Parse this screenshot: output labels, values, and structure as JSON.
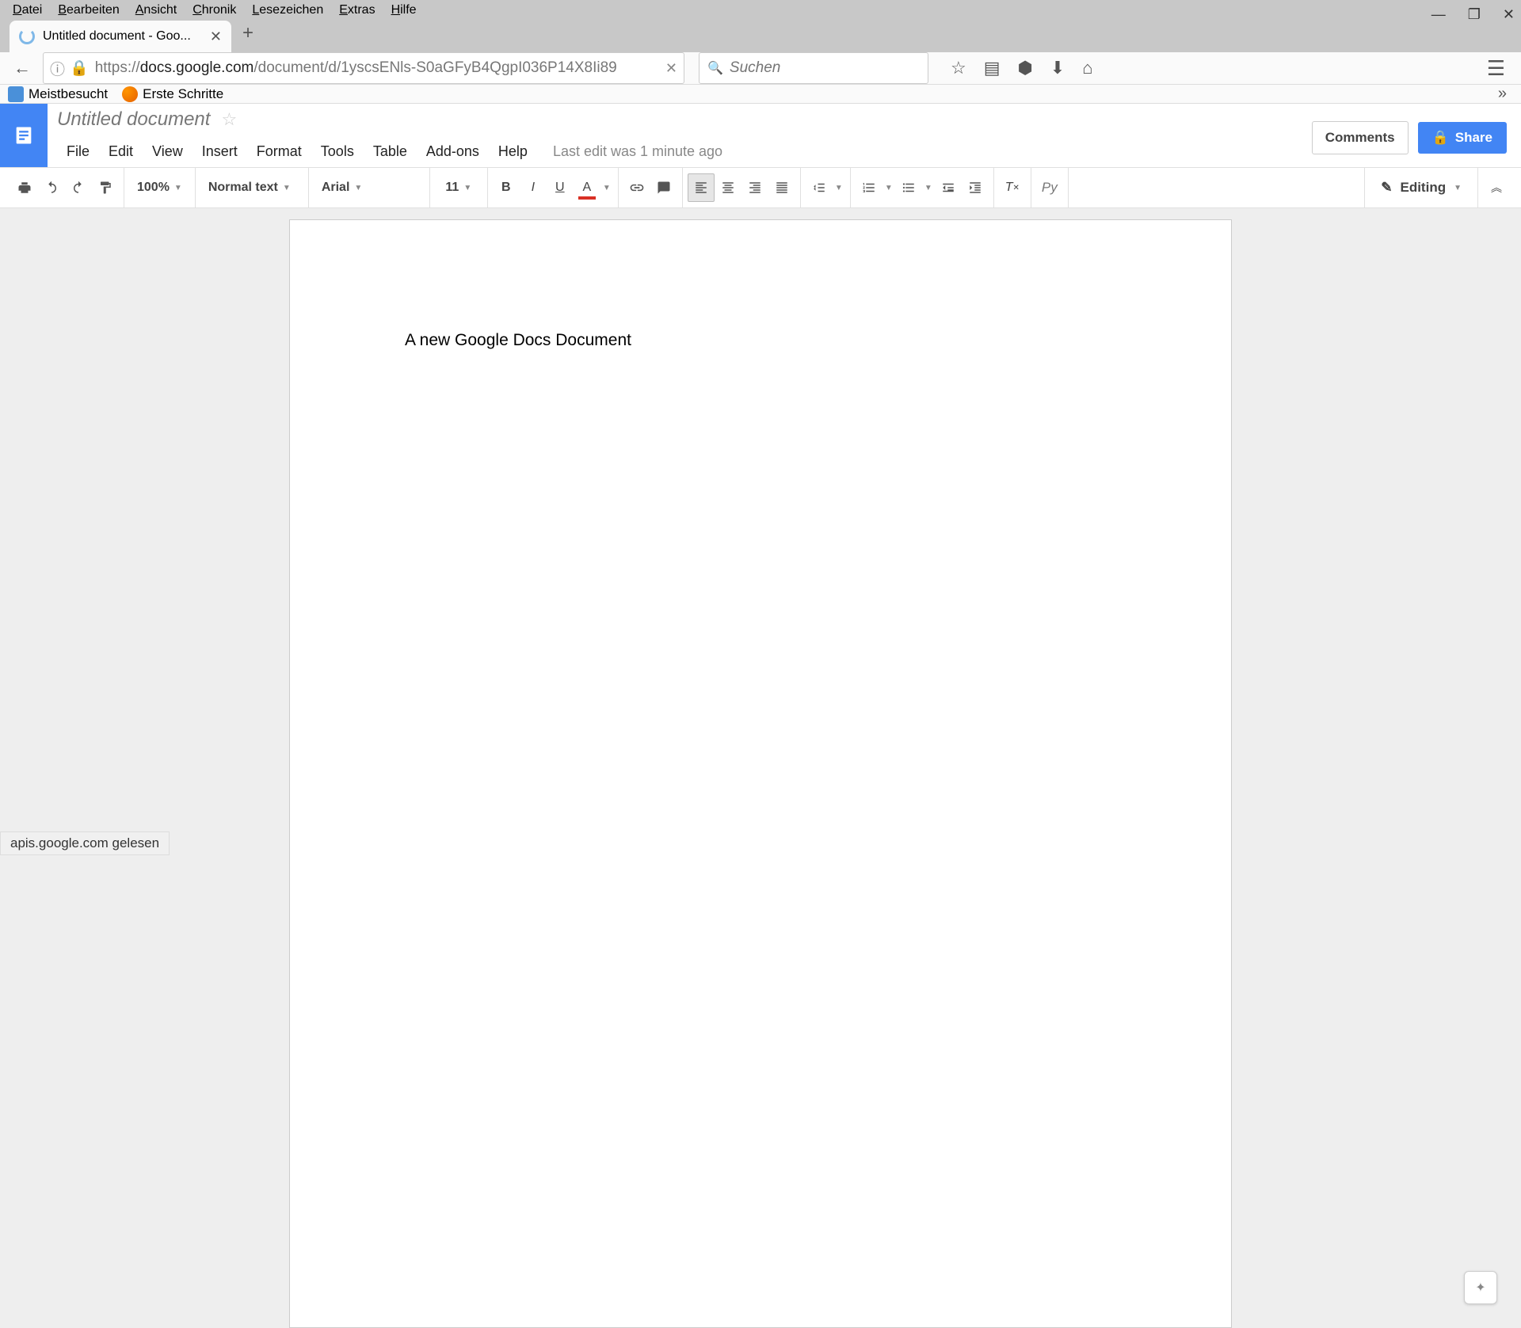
{
  "firefox": {
    "menubar": [
      "Datei",
      "Bearbeiten",
      "Ansicht",
      "Chronik",
      "Lesezeichen",
      "Extras",
      "Hilfe"
    ],
    "tab_title": "Untitled document - Goo...",
    "url_prefix": "https://",
    "url_domain": "docs.google.com",
    "url_path": "/document/d/1yscsENls-S0aGFyB4QgpI036P14X8Ii89",
    "search_placeholder": "Suchen",
    "bookmarks": {
      "meistbesucht": "Meistbesucht",
      "erste_schritte": "Erste Schritte"
    },
    "status": "apis.google.com gelesen"
  },
  "docs": {
    "title": "Untitled document",
    "menus": [
      "File",
      "Edit",
      "View",
      "Insert",
      "Format",
      "Tools",
      "Table",
      "Add-ons",
      "Help"
    ],
    "last_edit": "Last edit was 1 minute ago",
    "comments_label": "Comments",
    "share_label": "Share",
    "toolbar": {
      "zoom": "100%",
      "style": "Normal text",
      "font": "Arial",
      "size": "11",
      "input_tools": "Py",
      "editing": "Editing"
    },
    "page_content": "A new Google Docs Document"
  }
}
